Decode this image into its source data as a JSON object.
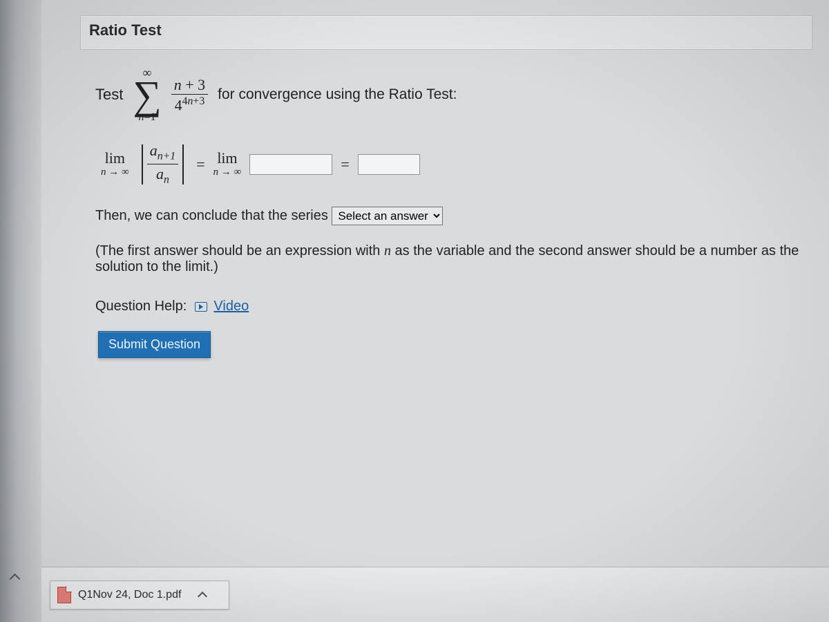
{
  "title": "Ratio Test",
  "question": {
    "test_word": "Test",
    "series": {
      "sigma_upper": "∞",
      "sigma_lower_var": "n",
      "sigma_lower_eq": "=1",
      "numerator": {
        "n": "n",
        "plus3": " + 3"
      },
      "denom_base": "4",
      "denom_exp_part1": "4",
      "denom_exp_n": "n",
      "denom_exp_part2": "+3"
    },
    "for_text": "for convergence using the Ratio Test:",
    "lim_label": "lim",
    "lim_under_n": "n",
    "lim_under_arrow": " → ∞",
    "ratio_top_a": "a",
    "ratio_top_sub": "n+1",
    "ratio_bot_a": "a",
    "ratio_bot_sub": "n",
    "equals": "=",
    "input1_value": "",
    "input2_value": "",
    "conclude_pre": "Then, we can conclude that the series ",
    "select_placeholder": "Select an answer",
    "hint": "(The first answer should be an expression with n as the variable and the second answer should be a number as the solution to the limit.)",
    "hint_ital_char": "n",
    "help_label": "Question Help:",
    "video_label": "Video",
    "submit_label": "Submit Question"
  },
  "downloads": {
    "item1_name": "Q1Nov 24, Doc 1.pdf"
  }
}
